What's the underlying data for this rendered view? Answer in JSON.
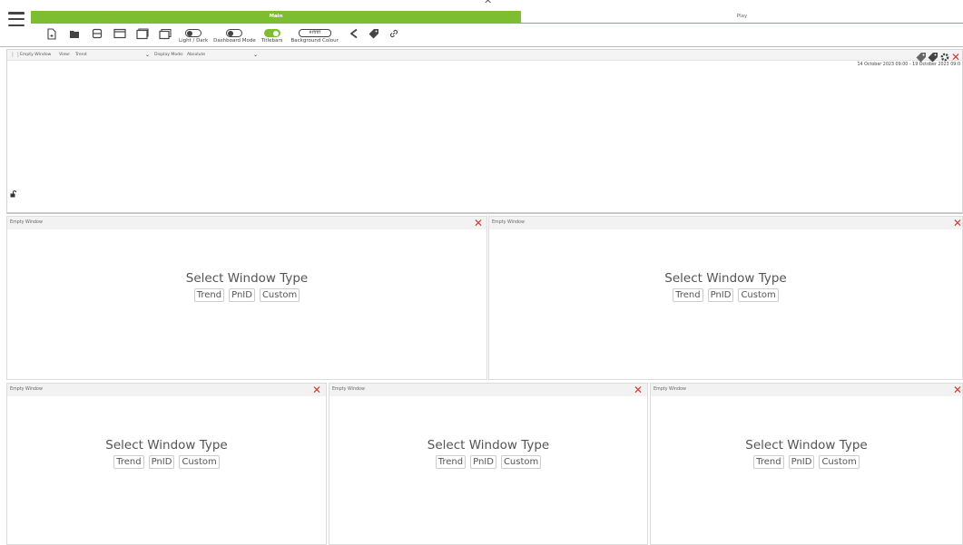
{
  "tabs": [
    {
      "label": "Main"
    },
    {
      "label": "Play"
    }
  ],
  "toolbar": {
    "icons": [
      "new-document-icon",
      "folder-icon",
      "save-icon",
      "window-icon",
      "window-stack-icon",
      "window-layers-icon"
    ],
    "toggles": {
      "light_dark": {
        "label": "Light / Dark",
        "on": false
      },
      "dashboard_mode": {
        "label": "Dashboard Mode",
        "on": false
      },
      "titlebars": {
        "label": "Titlebars",
        "on": true
      }
    },
    "background_colour": {
      "label": "Background Colour",
      "value": "#ffffff"
    },
    "extra_icons": [
      "share-icon",
      "tag-icon",
      "link-icon"
    ]
  },
  "top_window": {
    "title": "Empty Window",
    "view_label": "View:",
    "view_value": "Trend",
    "display_mode_label": "Display Mode:",
    "display_mode_value": "Absolute",
    "date_range": "14 October 2023 09:00 - 19 October 2023 09:0"
  },
  "windows": [
    {
      "title": "Empty Window",
      "heading": "Select Window Type",
      "buttons": [
        "Trend",
        "PnID",
        "Custom"
      ]
    },
    {
      "title": "Empty Window",
      "heading": "Select Window Type",
      "buttons": [
        "Trend",
        "PnID",
        "Custom"
      ]
    },
    {
      "title": "Empty Window",
      "heading": "Select Window Type",
      "buttons": [
        "Trend",
        "PnID",
        "Custom"
      ]
    },
    {
      "title": "Empty Window",
      "heading": "Select Window Type",
      "buttons": [
        "Trend",
        "PnID",
        "Custom"
      ]
    },
    {
      "title": "Empty Window",
      "heading": "Select Window Type",
      "buttons": [
        "Trend",
        "PnID",
        "Custom"
      ]
    }
  ],
  "colors": {
    "accent": "#7dbd2f",
    "close": "#d63a2a"
  }
}
